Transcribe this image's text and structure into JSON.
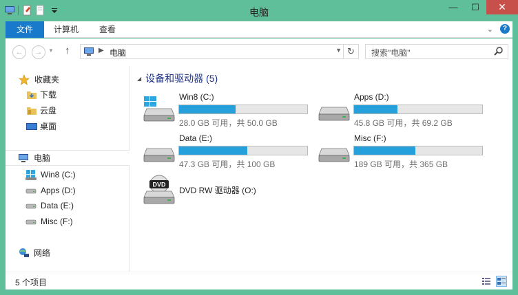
{
  "window": {
    "title": "电脑",
    "close": "✕",
    "minimize": "—",
    "maximize": "☐"
  },
  "ribbon": {
    "tabs": [
      "文件",
      "计算机",
      "查看"
    ],
    "expand": "⌄",
    "help": "?"
  },
  "nav": {
    "back": "←",
    "forward": "→",
    "up": "↑",
    "refresh": "↻",
    "address_crumb": "电脑",
    "search_placeholder": "搜索\"电脑\""
  },
  "sidebar": {
    "items": [
      {
        "label": "收藏夹",
        "icon": "star-icon"
      },
      {
        "label": "下载",
        "icon": "download-folder-icon"
      },
      {
        "label": "云盘",
        "icon": "cloud-folder-icon"
      },
      {
        "label": "桌面",
        "icon": "desktop-icon"
      },
      {
        "label": "电脑",
        "icon": "computer-icon"
      },
      {
        "label": "Win8 (C:)",
        "icon": "windows-drive-icon"
      },
      {
        "label": "Apps (D:)",
        "icon": "drive-icon"
      },
      {
        "label": "Data (E:)",
        "icon": "drive-icon"
      },
      {
        "label": "Misc (F:)",
        "icon": "drive-icon"
      },
      {
        "label": "网络",
        "icon": "network-icon"
      }
    ]
  },
  "content": {
    "group_title": "设备和驱动器 (5)",
    "drives": [
      {
        "name": "Win8 (C:)",
        "free_text": "28.0 GB 可用，共 50.0 GB",
        "used_fraction": 0.44,
        "icon": "windows-drive-icon"
      },
      {
        "name": "Apps (D:)",
        "free_text": "45.8 GB 可用，共 69.2 GB",
        "used_fraction": 0.34,
        "icon": "drive-icon"
      },
      {
        "name": "Data (E:)",
        "free_text": "47.3 GB 可用，共 100 GB",
        "used_fraction": 0.53,
        "icon": "drive-icon"
      },
      {
        "name": "Misc (F:)",
        "free_text": "189 GB 可用，共 365 GB",
        "used_fraction": 0.48,
        "icon": "drive-icon"
      }
    ],
    "dvd": {
      "name": "DVD RW 驱动器 (O:)",
      "badge": "DVD",
      "icon": "dvd-drive-icon"
    }
  },
  "status": {
    "count": "5 个项目"
  },
  "colors": {
    "accent": "#1979ca",
    "frame": "#5fbf9b",
    "bar_fill": "#26a0da",
    "close": "#c7514a"
  }
}
